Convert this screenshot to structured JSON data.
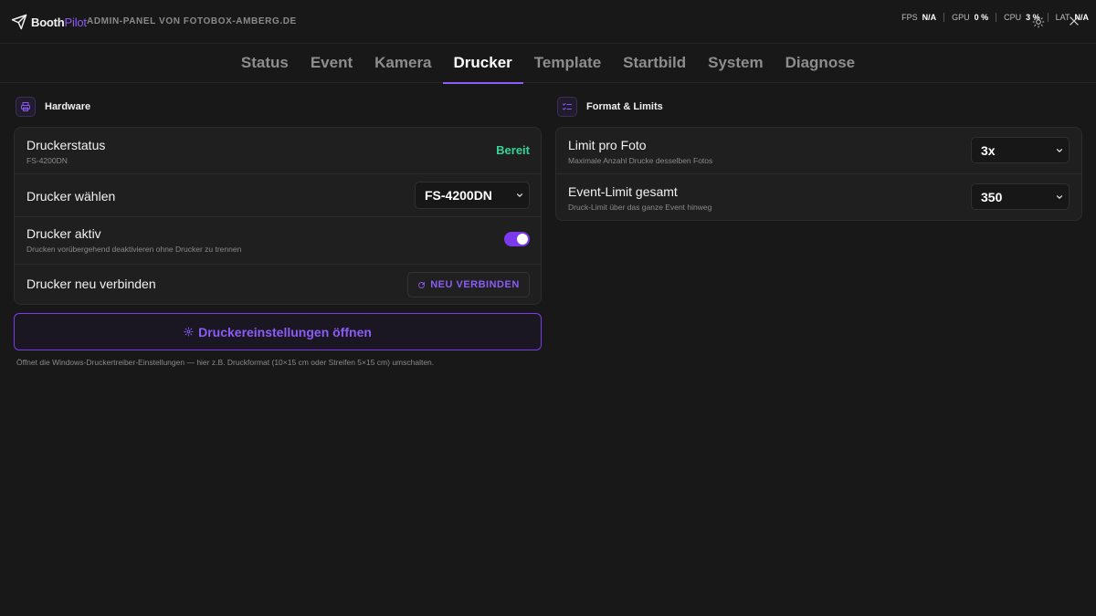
{
  "header": {
    "brand_part1": "Booth",
    "brand_part2": "Pilot",
    "subtitle": "ADMIN-PANEL VON FOTOBOX-AMBERG.DE",
    "stats": [
      {
        "key": "FPS",
        "value": "N/A"
      },
      {
        "key": "GPU",
        "value": "0 %"
      },
      {
        "key": "CPU",
        "value": "3 %"
      },
      {
        "key": "LAT",
        "value": "N/A"
      }
    ]
  },
  "tabs": [
    {
      "label": "Status"
    },
    {
      "label": "Event"
    },
    {
      "label": "Kamera"
    },
    {
      "label": "Drucker",
      "active": true
    },
    {
      "label": "Template"
    },
    {
      "label": "Startbild"
    },
    {
      "label": "System"
    },
    {
      "label": "Diagnose"
    }
  ],
  "hardware": {
    "title": "Hardware",
    "status_title": "Druckerstatus",
    "status_sub": "FS-4200DN",
    "status_value": "Bereit",
    "select_title": "Drucker wählen",
    "select_value": "FS-4200DN",
    "active_title": "Drucker aktiv",
    "active_sub": "Drucken vorübergehend deaktivieren ohne Drucker zu trennen",
    "active_on": true,
    "reconnect_title": "Drucker neu verbinden",
    "reconnect_button": "NEU VERBINDEN",
    "settings_button": "Druckereinstellungen öffnen",
    "hint": "Öffnet die Windows-Druckertreiber-Einstellungen — hier z.B. Druckformat (10×15 cm oder Streifen 5×15 cm) umschalten."
  },
  "format": {
    "title": "Format & Limits",
    "limit_title": "Limit pro Foto",
    "limit_sub": "Maximale Anzahl Drucke desselben Fotos",
    "limit_value": "3x",
    "event_title": "Event-Limit gesamt",
    "event_sub": "Druck-Limit über das ganze Event hinweg",
    "event_value": "350"
  },
  "colors": {
    "accent": "#8b5cf6",
    "ready": "#34d399",
    "background": "#181818"
  },
  "icons": [
    "paper-plane-icon",
    "sun-icon",
    "close-icon",
    "printer-icon",
    "checklist-icon",
    "chevron-down-icon",
    "refresh-icon",
    "gear-icon"
  ]
}
